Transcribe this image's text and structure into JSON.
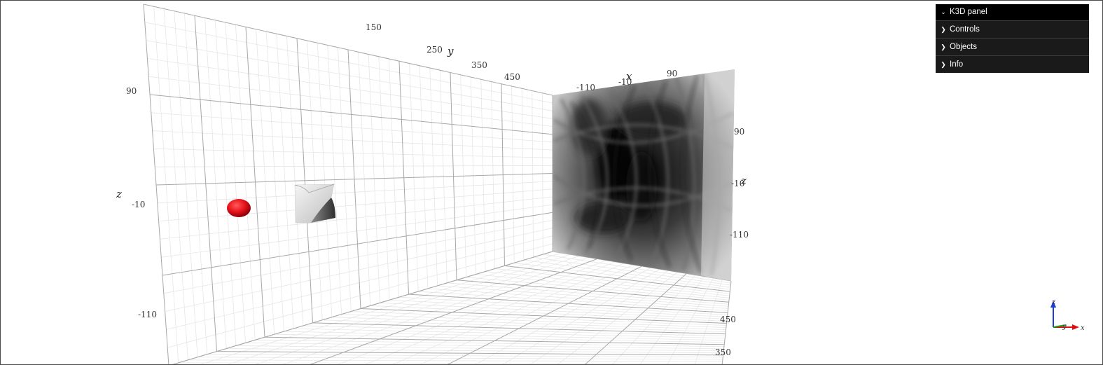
{
  "scene": {
    "back_wall_z_ticks": [
      "90",
      "-10",
      "-110"
    ],
    "back_wall_y_ticks": [
      "150",
      "250",
      "350",
      "450"
    ],
    "axis_y": "y",
    "axis_z": "z",
    "right_wall_x_ticks": [
      "-110",
      "-10",
      "90"
    ],
    "right_wall_z_ticks": [
      "90",
      "-10",
      "-110"
    ],
    "axis_x": "x",
    "axis_z2": "z",
    "floor_y_ticks": [
      "450",
      "350"
    ],
    "sphere_color": "#e8141b",
    "cube_color": "#d9d9d9"
  },
  "panel": {
    "title": "K3D panel",
    "items": [
      {
        "label": "Controls"
      },
      {
        "label": "Objects"
      },
      {
        "label": "Info"
      }
    ],
    "background": "#1a1a1a"
  },
  "gizmo": {
    "z": "z",
    "x": "x",
    "y": "y",
    "z_color": "#1a3fd8",
    "x_color": "#e01010",
    "y_color": "#1b9e1b"
  }
}
